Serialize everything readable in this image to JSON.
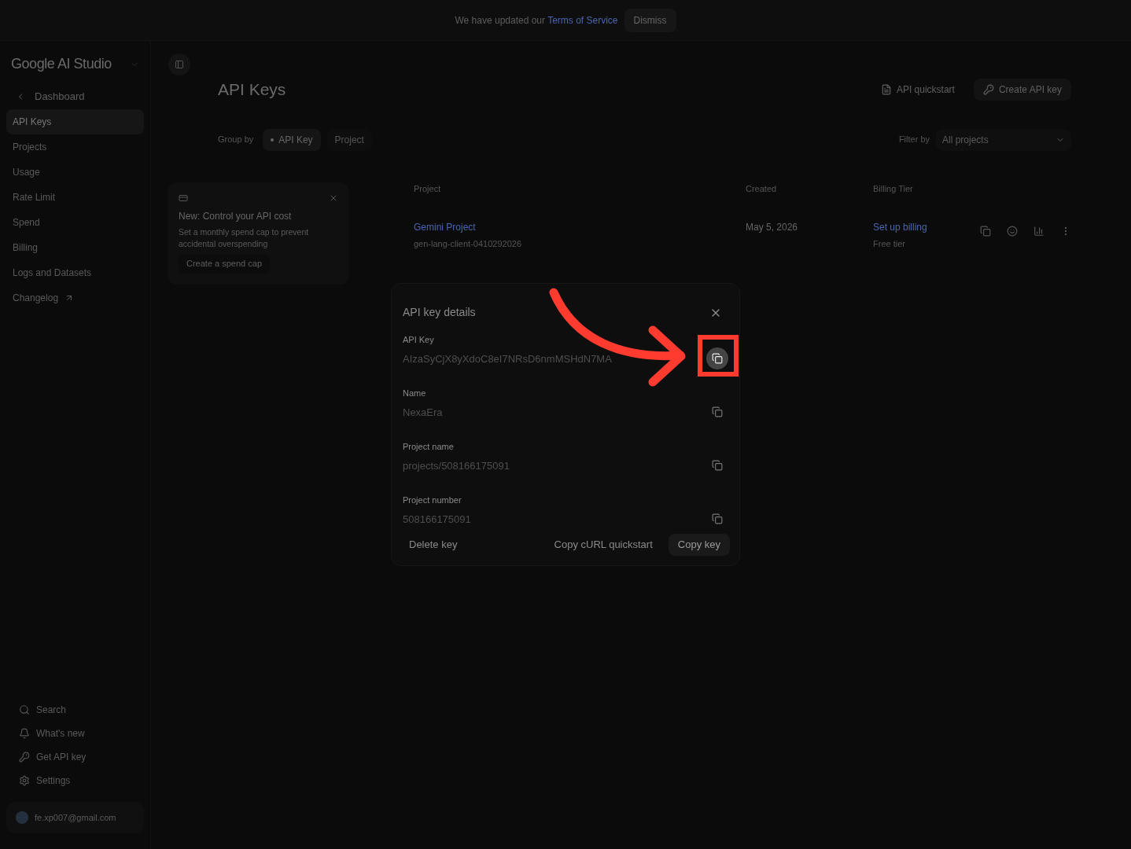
{
  "banner": {
    "text": "We have updated our",
    "link": "Terms of Service",
    "button": "Dismiss"
  },
  "sidebar": {
    "brand": "Google AI Studio",
    "back": "Dashboard",
    "items": [
      {
        "label": "API Keys",
        "selected": true
      },
      {
        "label": "Projects",
        "selected": false
      },
      {
        "label": "Usage",
        "selected": false
      },
      {
        "label": "Rate Limit",
        "selected": false
      },
      {
        "label": "Spend",
        "selected": false
      },
      {
        "label": "Billing",
        "selected": false
      },
      {
        "label": "Logs and Datasets",
        "selected": false
      },
      {
        "label": "Changelog",
        "selected": false,
        "external": true
      }
    ],
    "bottom": [
      {
        "kind": "search",
        "label": "Search"
      },
      {
        "kind": "news",
        "label": "What's new"
      },
      {
        "kind": "key",
        "label": "Get API key"
      },
      {
        "kind": "settings",
        "label": "Settings"
      }
    ],
    "account": "fe.xp007@gmail.com"
  },
  "page": {
    "title": "API Keys",
    "quickstart": "API quickstart",
    "create": "Create API key",
    "group_label": "Group by",
    "groups": [
      {
        "label": "API Key",
        "selected": true
      },
      {
        "label": "Project",
        "selected": false
      }
    ],
    "filter_label": "Filter by",
    "filter_value": "All projects"
  },
  "promo": {
    "title": "New: Control your API cost",
    "body": "Set a monthly spend cap to prevent accidental overspending",
    "button": "Create a spend cap"
  },
  "table": {
    "columns": [
      "Project",
      "Created",
      "Billing Tier"
    ],
    "rows": [
      {
        "project": "Gemini Project",
        "project_id": "gen-lang-client-0410292026",
        "created": "May 5, 2026",
        "billing": "Set up billing",
        "tier": "Free tier"
      }
    ]
  },
  "dialog": {
    "title": "API key details",
    "fields": [
      {
        "label": "API Key",
        "value": "AIzaSyCjX8yXdoC8eI7NRsD6nmMSHdN7MA",
        "highlighted": true
      },
      {
        "label": "Name",
        "value": "NexaEra",
        "highlighted": false
      },
      {
        "label": "Project name",
        "value": "projects/508166175091",
        "highlighted": false
      },
      {
        "label": "Project number",
        "value": "508166175091",
        "highlighted": false
      }
    ],
    "delete": "Delete key",
    "curl": "Copy cURL quickstart",
    "copy": "Copy key"
  }
}
